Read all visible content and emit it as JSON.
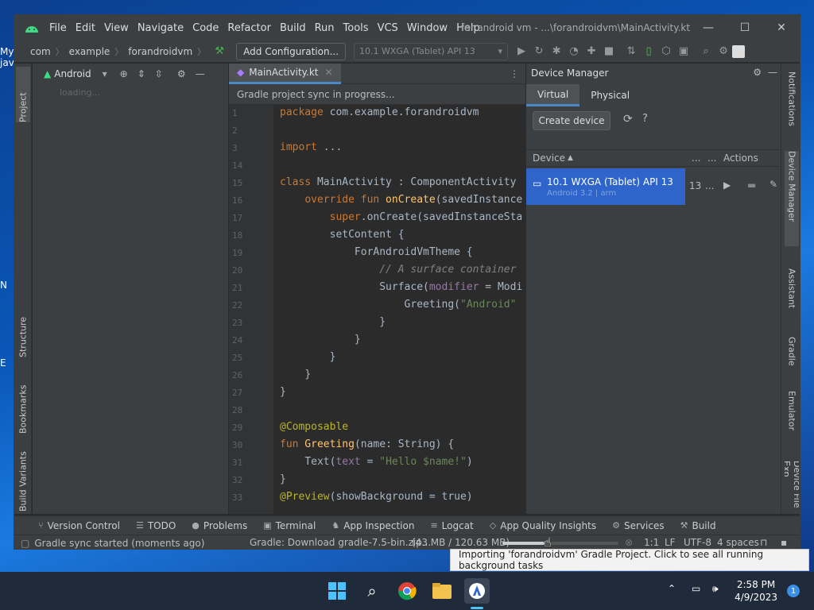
{
  "desktop": {
    "partial_label_1": "My java",
    "partial_label_2": "N",
    "partial_label_3": "E"
  },
  "window": {
    "menu": [
      "File",
      "Edit",
      "View",
      "Navigate",
      "Code",
      "Refactor",
      "Build",
      "Run",
      "Tools",
      "VCS",
      "Window",
      "Help"
    ],
    "title": "for android vm - ...\\forandroidvm\\MainActivity.kt"
  },
  "navbar": {
    "breadcrumbs": [
      "com",
      "example",
      "forandroidvm"
    ],
    "add_config": "Add Configuration...",
    "device_select": "10.1  WXGA (Tablet) API 13"
  },
  "left_strip": {
    "project": "Project",
    "structure": "Structure",
    "bookmarks": "Bookmarks",
    "build_variants": "Build Variants"
  },
  "project_panel": {
    "view": "Android",
    "loading": "loading..."
  },
  "editor": {
    "tab": "MainActivity.kt",
    "sync_message": "Gradle project sync in progress...",
    "lines": [
      {
        "n": "1",
        "html": "package",
        "rest": " com.example.forandroidvm"
      },
      {
        "n": "2"
      },
      {
        "n": "3",
        "kw": "import",
        "rest": " ..."
      },
      {
        "n": "14"
      },
      {
        "n": "15",
        "kw": "class",
        "rest": " MainActivity : ComponentActivity"
      },
      {
        "n": "16",
        "indent": "    ",
        "kw": "override fun",
        "fn": " onCreate",
        "rest": "(savedInstance"
      },
      {
        "n": "17",
        "indent": "        ",
        "kw": "super",
        "rest": ".onCreate(savedInstanceSta"
      },
      {
        "n": "18",
        "indent": "        ",
        "rest": "setContent {"
      },
      {
        "n": "19",
        "indent": "            ",
        "rest": "ForAndroidVmTheme {"
      },
      {
        "n": "20",
        "indent": "                ",
        "cmt": "// A surface container"
      },
      {
        "n": "21",
        "indent": "                ",
        "rest": "Surface(",
        "prm": "modifier",
        "rest2": " = Modi"
      },
      {
        "n": "22",
        "indent": "                    ",
        "rest": "Greeting(",
        "str": "\"Android\""
      },
      {
        "n": "23",
        "indent": "                ",
        "rest": "}"
      },
      {
        "n": "24",
        "indent": "            ",
        "rest": "}"
      },
      {
        "n": "25",
        "indent": "        ",
        "rest": "}"
      },
      {
        "n": "26",
        "indent": "    ",
        "rest": "}"
      },
      {
        "n": "27",
        "rest": "}"
      },
      {
        "n": "28"
      },
      {
        "n": "29",
        "ann": "@Composable"
      },
      {
        "n": "30",
        "kw": "fun",
        "fn": " Greeting",
        "rest": "(name: String) {"
      },
      {
        "n": "31",
        "indent": "    ",
        "rest": "Text(",
        "prm": "text",
        "rest2": " = ",
        "str": "\"Hello $name!\"",
        "rest3": ")"
      },
      {
        "n": "32",
        "rest": "}"
      },
      {
        "n": "33",
        "ann": "@Preview",
        "rest": "(showBackground = true)"
      }
    ]
  },
  "device_manager": {
    "title": "Device Manager",
    "tabs": [
      "Virtual",
      "Physical"
    ],
    "create_button": "Create device",
    "columns": {
      "device": "Device",
      "dots1": "...",
      "dots2": "...",
      "actions": "Actions"
    },
    "device": {
      "name": "10.1  WXGA (Tablet) API 13",
      "sub": "Android 3.2 | arm",
      "api": "13",
      "dots": "..."
    }
  },
  "right_strip": [
    "Notifications",
    "Device Manager",
    "Assistant",
    "Gradle",
    "Emulator",
    "Device File Exp"
  ],
  "bottom_tools": [
    "Version Control",
    "TODO",
    "Problems",
    "Terminal",
    "App Inspection",
    "Logcat",
    "App Quality Insights",
    "Services",
    "Build"
  ],
  "status": {
    "left": "Gradle sync started (moments ago)",
    "download": "Gradle: Download gradle-7.5-bin.zip...",
    "size": "(43 MB / 120.63 MB)",
    "progress": 0.36,
    "position": "1:1",
    "line_ending": "LF",
    "encoding": "UTF-8",
    "indent": "4 spaces"
  },
  "tooltip": "Importing 'forandroidvm' Gradle Project. Click to see all running background tasks",
  "taskbar": {
    "time": "2:58 PM",
    "date": "4/9/2023",
    "notifications": "1"
  },
  "colors": {
    "accent": "#4a88c7",
    "selection": "#2f65ca",
    "ide_bg": "#2b2b2b",
    "panel_bg": "#3c3f41"
  }
}
